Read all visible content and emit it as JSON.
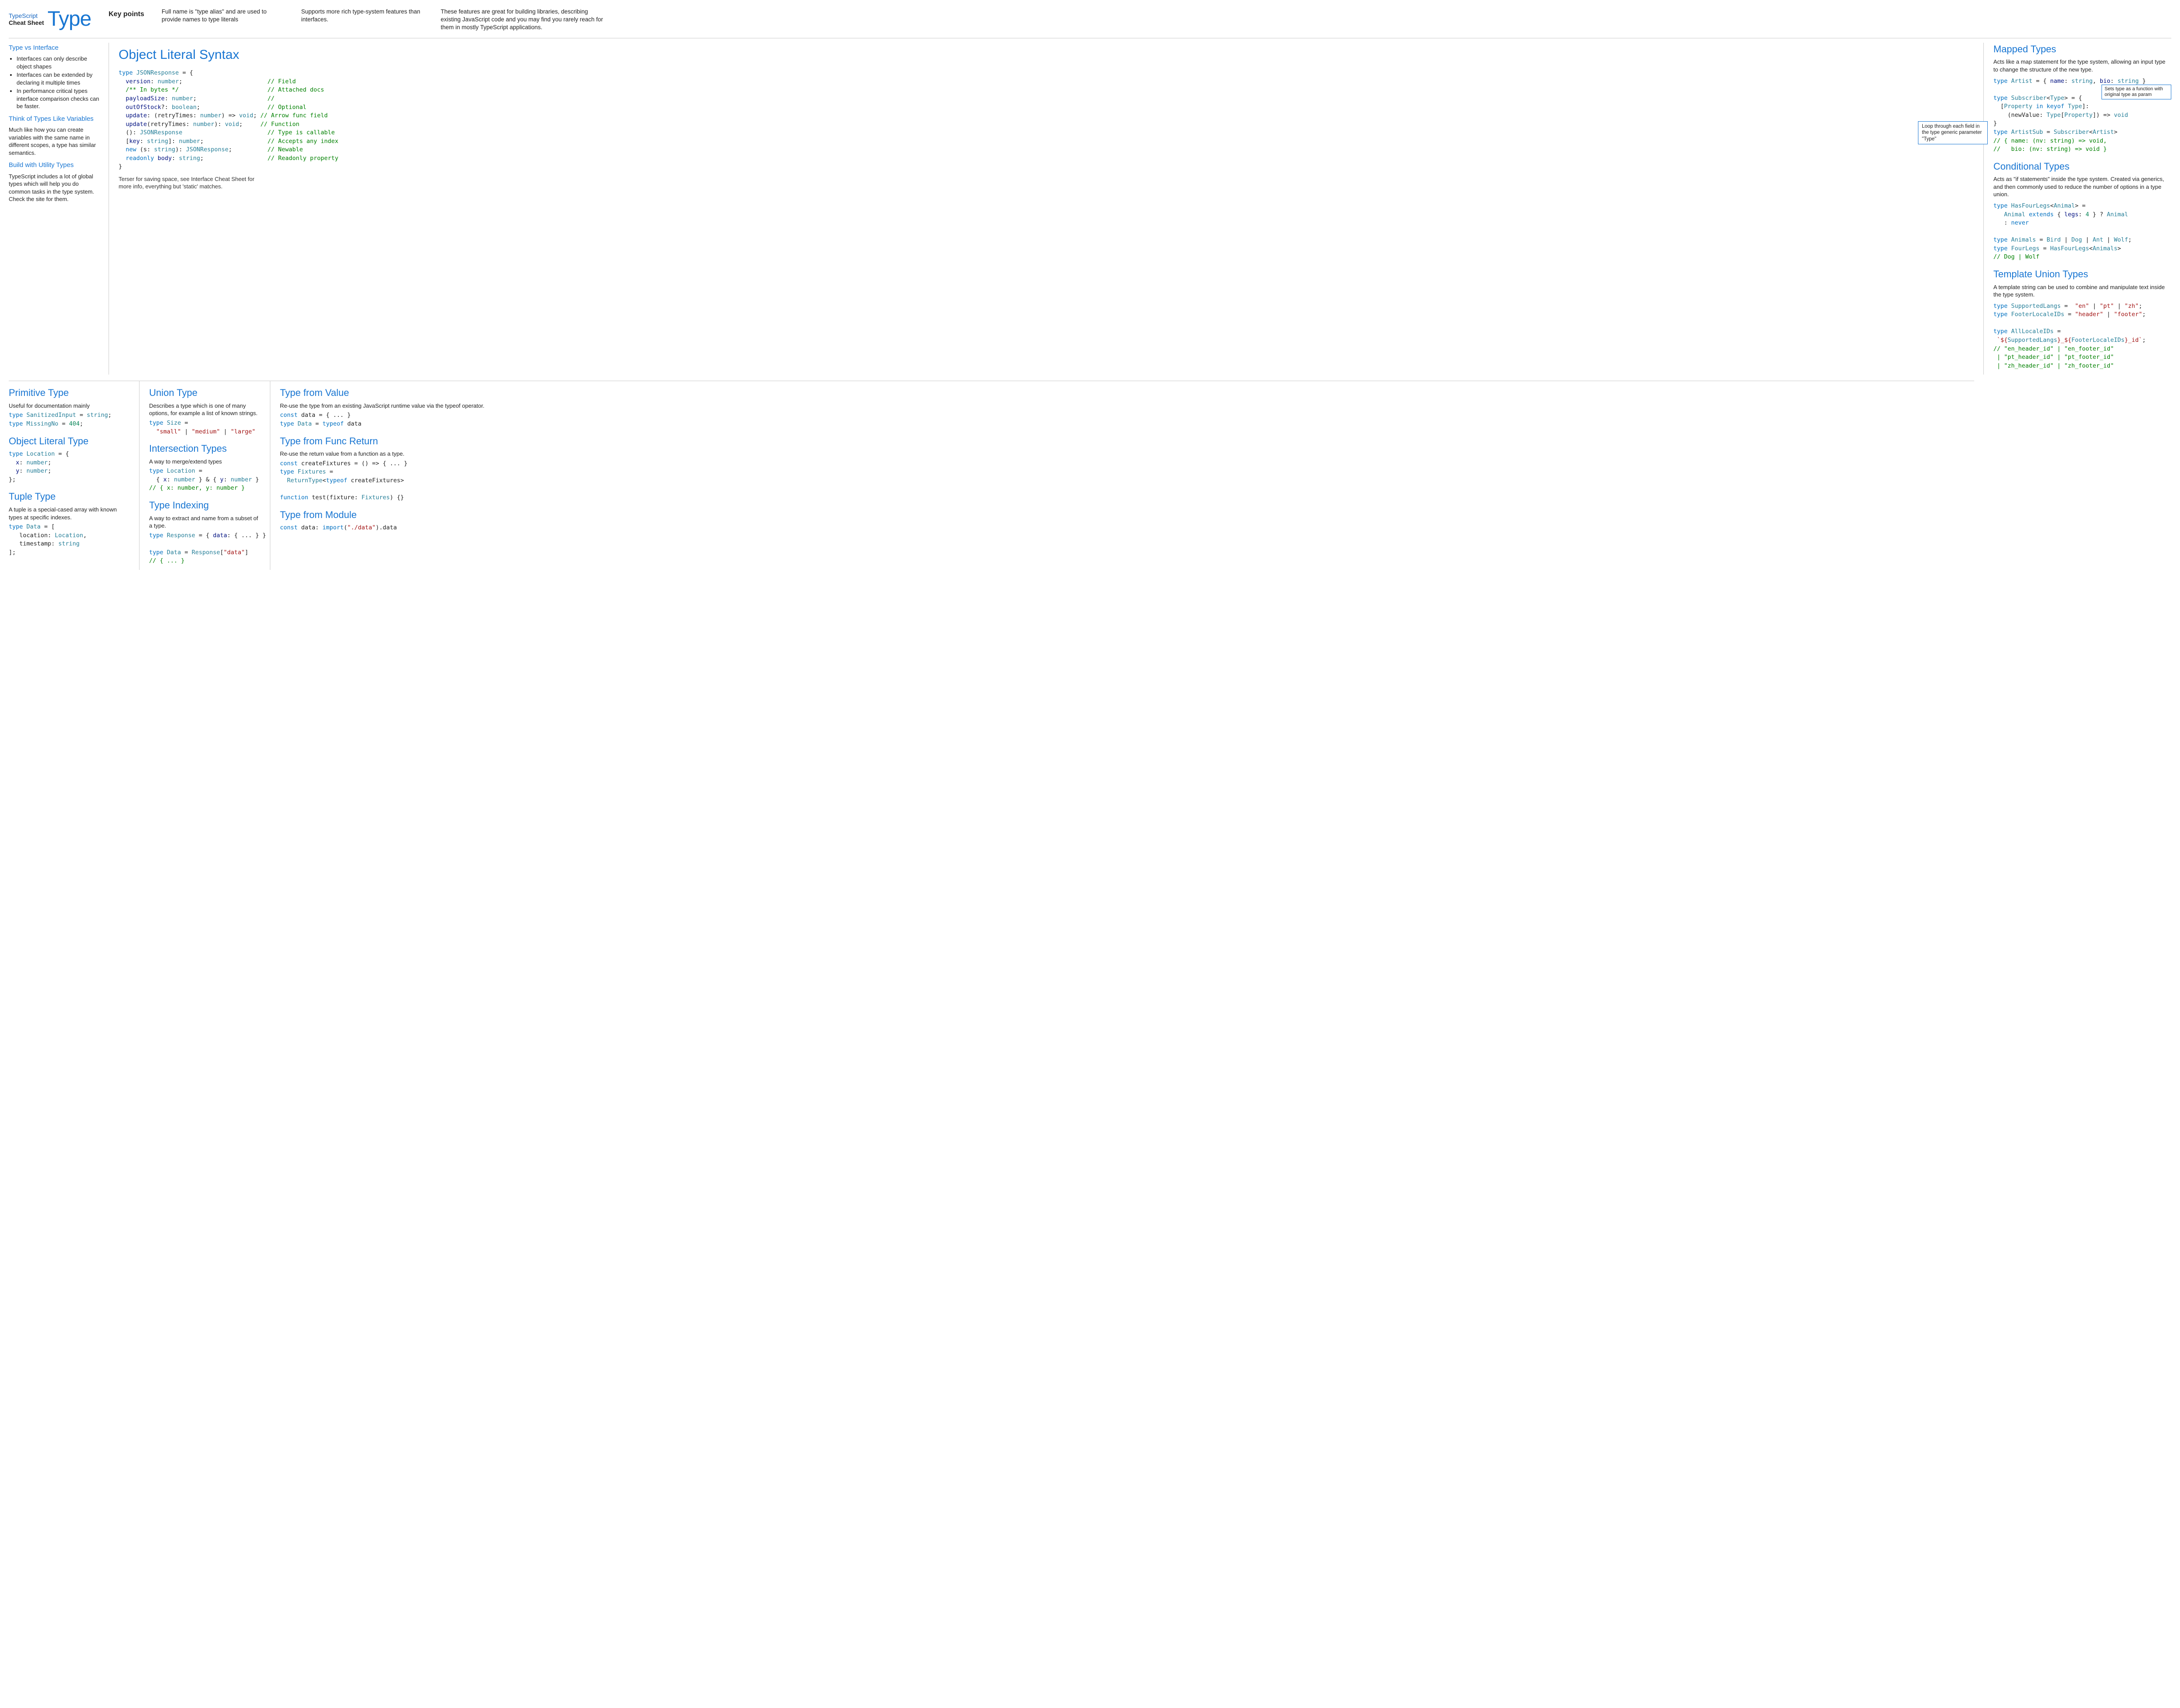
{
  "header": {
    "logo_line1": "TypeScript",
    "logo_line2": "Cheat Sheet",
    "logo_big": "Type",
    "key_points": "Key points",
    "kp1": "Full name is \"type alias\" and are used to provide names to type literals",
    "kp2": "Supports more rich type-system features than interfaces.",
    "kp3": "These features are great for building libraries, describing existing JavaScript code and you may find you rarely reach for them in mostly TypeScript applications."
  },
  "left": {
    "h1": "Type vs Interface",
    "li1": "Interfaces can only describe object shapes",
    "li2": "Interfaces can be extended by declaring it multiple times",
    "li3": "In performance critical types interface comparison checks can be faster.",
    "h2": "Think of Types Like Variables",
    "p2": "Much like how you can create variables with the same name in different scopes, a type has similar semantics.",
    "h3": "Build with Utility Types",
    "p3": "TypeScript includes a lot of global types which will help you do common tasks in the type system. Check the site for them."
  },
  "ols": {
    "title": "Object Literal Syntax",
    "note": "Terser for saving space, see Interface Cheat Sheet for more info, everything but 'static' matches.",
    "callout": "Loop through each field in the type generic parameter \"Type\"",
    "c_field": "// Field",
    "c_docs": "// Attached docs",
    "c_blank": "//",
    "c_optional": "// Optional",
    "c_arrow": "// Arrow func field",
    "c_func": "// Function",
    "c_callable": "// Type is callable",
    "c_index": "// Accepts any index",
    "c_newable": "// Newable",
    "c_readonly": "// Readonly property"
  },
  "prim": {
    "h": "Primitive Type",
    "p": "Useful for documentation mainly"
  },
  "objlit": {
    "h": "Object Literal Type"
  },
  "tuple": {
    "h": "Tuple Type",
    "p": "A tuple is a special-cased array with known types at specific indexes."
  },
  "union": {
    "h": "Union Type",
    "p": "Describes a type which is one of many options, for example a list of known strings."
  },
  "inter": {
    "h": "Intersection Types",
    "p": "A way to merge/extend types"
  },
  "index": {
    "h": "Type Indexing",
    "p": "A way to extract and name from a subset of a type."
  },
  "tval": {
    "h": "Type from Value",
    "p": "Re-use the type from an existing JavaScript runtime value via the typeof operator."
  },
  "tret": {
    "h": "Type from Func Return",
    "p": "Re-use the return value from a function as a type."
  },
  "tmod": {
    "h": "Type from Module"
  },
  "mapped": {
    "h": "Mapped Types",
    "p": "Acts like a map statement for the type system, allowing an input type to change the structure of the new type.",
    "callout2": "Sets type as a function with original type as param"
  },
  "cond": {
    "h": "Conditional Types",
    "p": "Acts as \"if statements\"  inside the type system. Created via generics, and then commonly used to reduce the number of options in a type union."
  },
  "tmpl": {
    "h": "Template Union Types",
    "p": "A template string can be used to combine and manipulate text inside the type system."
  }
}
